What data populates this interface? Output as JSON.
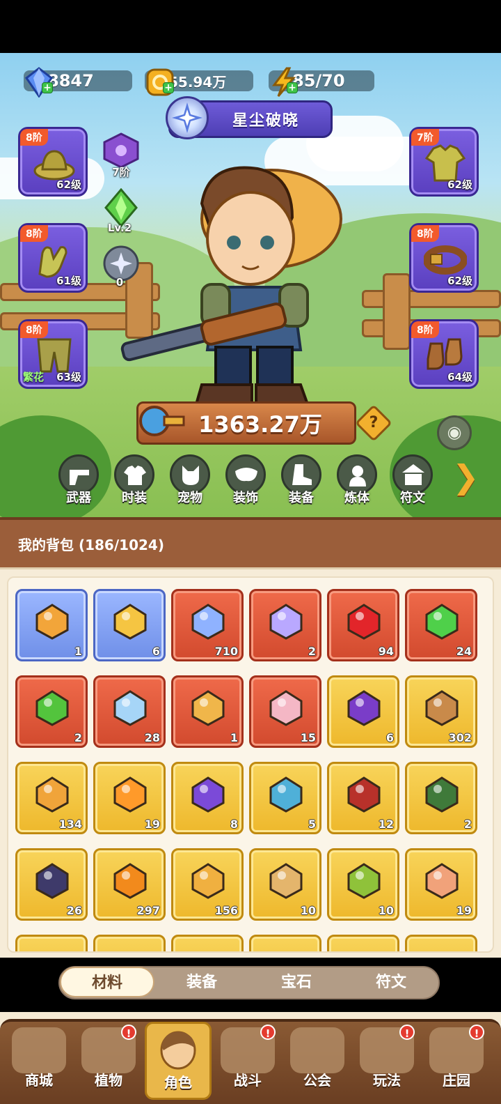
{
  "resources": {
    "gems": "8847",
    "coins": "55.94万",
    "energy": "85/70"
  },
  "title_banner": "星尘破晓",
  "gear_left": [
    {
      "tier": "8阶",
      "level": "62级",
      "tag": ""
    },
    {
      "tier": "8阶",
      "level": "61级",
      "tag": ""
    },
    {
      "tier": "8阶",
      "level": "63级",
      "tag": "繁花"
    }
  ],
  "gear_right": [
    {
      "tier": "7阶",
      "level": "62级"
    },
    {
      "tier": "8阶",
      "level": "62级"
    },
    {
      "tier": "8阶",
      "level": "64级"
    }
  ],
  "mini_slots": {
    "pet_tier": "7阶",
    "crystal_level": "Lv.2",
    "orb_count": "0"
  },
  "power": "1363.27万",
  "help_symbol": "?",
  "categories": [
    "武器",
    "时装",
    "宠物",
    "装饰",
    "装备",
    "炼体",
    "符文"
  ],
  "next_symbol": "❯",
  "bag": {
    "title": "我的背包 (186/1024)",
    "items": [
      {
        "rarity": "blue",
        "count": "1",
        "icon": "card-icon",
        "color": "#f2a53a"
      },
      {
        "rarity": "blue",
        "count": "6",
        "icon": "syringe-icon",
        "color": "#f5c542"
      },
      {
        "rarity": "red",
        "count": "710",
        "icon": "crystal-star-icon",
        "color": "#8fb2ff"
      },
      {
        "rarity": "red",
        "count": "2",
        "icon": "moon-star-icon",
        "color": "#b9a8ff"
      },
      {
        "rarity": "red",
        "count": "94",
        "icon": "potion-red-icon",
        "color": "#e2252a"
      },
      {
        "rarity": "red",
        "count": "24",
        "icon": "green-tube-icon",
        "color": "#4fd04a"
      },
      {
        "rarity": "red",
        "count": "2",
        "icon": "green-capsule-icon",
        "color": "#53c43d"
      },
      {
        "rarity": "red",
        "count": "28",
        "icon": "ice-star-icon",
        "color": "#a6d5f7"
      },
      {
        "rarity": "red",
        "count": "1",
        "icon": "scissors-icon",
        "color": "#f0b64a"
      },
      {
        "rarity": "red",
        "count": "15",
        "icon": "knot-icon",
        "color": "#f4b7c5"
      },
      {
        "rarity": "gold",
        "count": "6",
        "icon": "skull-puzzle-icon",
        "color": "#7a3dc8"
      },
      {
        "rarity": "gold",
        "count": "302",
        "icon": "basket-icon",
        "color": "#c98a4a"
      },
      {
        "rarity": "gold",
        "count": "134",
        "icon": "key-icon",
        "color": "#f0a43a"
      },
      {
        "rarity": "gold",
        "count": "19",
        "icon": "pyramid-icon",
        "color": "#ff9a2a"
      },
      {
        "rarity": "gold",
        "count": "8",
        "icon": "purple-orb-icon",
        "color": "#7b4ad8"
      },
      {
        "rarity": "gold",
        "count": "5",
        "icon": "mushroom-icon",
        "color": "#4fb0d8"
      },
      {
        "rarity": "gold",
        "count": "12",
        "icon": "book-icon",
        "color": "#b8312a"
      },
      {
        "rarity": "gold",
        "count": "2",
        "icon": "green-cube-icon",
        "color": "#3f7a3a"
      },
      {
        "rarity": "gold",
        "count": "26",
        "icon": "rune-stone-icon",
        "color": "#3e3a6a"
      },
      {
        "rarity": "gold",
        "count": "297",
        "icon": "orange-potion-icon",
        "color": "#f28a1c"
      },
      {
        "rarity": "gold",
        "count": "156",
        "icon": "sand-pile-icon",
        "color": "#f0b040"
      },
      {
        "rarity": "gold",
        "count": "10",
        "icon": "flower-pot-icon",
        "color": "#e4b56c"
      },
      {
        "rarity": "gold",
        "count": "10",
        "icon": "sprayer-icon",
        "color": "#8fc23a"
      },
      {
        "rarity": "gold",
        "count": "19",
        "icon": "cake-icon",
        "color": "#f1a27a"
      }
    ],
    "partial_row_rarities": [
      "gold",
      "gold",
      "gold",
      "gold",
      "gold",
      "gold"
    ]
  },
  "tabs": [
    {
      "label": "材料",
      "active": true
    },
    {
      "label": "装备",
      "active": false
    },
    {
      "label": "宝石",
      "active": false
    },
    {
      "label": "符文",
      "active": false
    }
  ],
  "bottom_nav": [
    {
      "label": "商城",
      "badge": "",
      "active": false
    },
    {
      "label": "植物",
      "badge": "!",
      "active": false
    },
    {
      "label": "角色",
      "badge": "",
      "active": true
    },
    {
      "label": "战斗",
      "badge": "!",
      "active": false
    },
    {
      "label": "公会",
      "badge": "",
      "active": false
    },
    {
      "label": "玩法",
      "badge": "!",
      "active": false
    },
    {
      "label": "庄园",
      "badge": "!",
      "active": false
    }
  ],
  "colors": {
    "slot_purple": "#6a4fd0",
    "tier_orange": "#f25a2c",
    "accent_gold": "#f2b02e",
    "panel_brown": "#9b5e3a"
  }
}
